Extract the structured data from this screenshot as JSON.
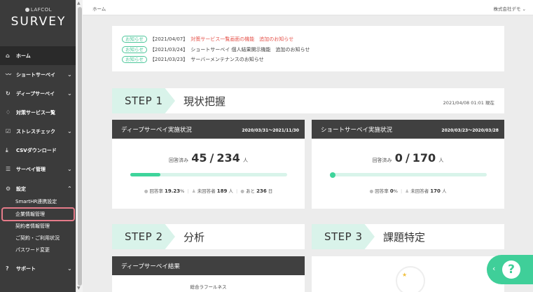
{
  "brand": {
    "sub": "LAFCOL",
    "main": "SURVEY"
  },
  "sidebar": {
    "items": [
      {
        "label": "ホーム",
        "icon": "home-icon",
        "glyph": "⌂",
        "chevron": ""
      },
      {
        "label": "ショートサーベイ",
        "icon": "chart-line-icon",
        "glyph": "〰",
        "chevron": "⌄"
      },
      {
        "label": "ディープサーベイ",
        "icon": "refresh-icon",
        "glyph": "↻",
        "chevron": "⌄"
      },
      {
        "label": "対策サービス一覧",
        "icon": "lightbulb-icon",
        "glyph": "♢",
        "chevron": ""
      },
      {
        "label": "ストレスチェック",
        "icon": "checkbox-icon",
        "glyph": "☑",
        "chevron": "⌄"
      },
      {
        "label": "CSVダウンロード",
        "icon": "download-icon",
        "glyph": "⤓",
        "chevron": ""
      },
      {
        "label": "サーベイ管理",
        "icon": "list-icon",
        "glyph": "☰",
        "chevron": "⌄"
      },
      {
        "label": "設定",
        "icon": "gear-icon",
        "glyph": "⚙",
        "chevron": "⌃"
      }
    ],
    "sub_items": [
      "SmartHR連携設定",
      "企業情報管理",
      "契約者情報管理",
      "ご契約・ご利用状況",
      "パスワード変更"
    ],
    "support": {
      "label": "サポート",
      "glyph": "?",
      "chevron": "⌄"
    }
  },
  "header": {
    "breadcrumb": "ホーム",
    "company": "株式会社デモ ⌄"
  },
  "notices": [
    {
      "tag": "お知らせ",
      "date": "【2021/04/07】",
      "title": "対策サービス一覧画面の機能　追加のお知らせ",
      "highlight": true
    },
    {
      "tag": "お知らせ",
      "date": "【2021/03/24】",
      "title": "ショートサーベイ 個人結果開示機能　追加のお知らせ",
      "highlight": false
    },
    {
      "tag": "お知らせ",
      "date": "【2021/03/23】",
      "title": "サーバーメンテナンスのお知らせ",
      "highlight": false
    }
  ],
  "step1": {
    "label": "STEP 1",
    "title": "現状把握",
    "date": "2021/04/08 01:01 現在"
  },
  "deep_panel": {
    "title": "ディープサーベイ実施状況",
    "range": "2020/03/31～2021/11/30",
    "answered_label": "回答済み",
    "answered": "45",
    "total": "234",
    "unit": "人",
    "progress": 0.1923,
    "rate_label": "回答率",
    "rate": "19.23",
    "rate_unit": "%",
    "unanswered_label": "未回答者",
    "unanswered": "189",
    "unanswered_unit": "人",
    "remain_label": "あと",
    "remain": "236",
    "remain_unit": "日"
  },
  "short_panel": {
    "title": "ショートサーベイ実施状況",
    "range": "2020/03/23～2020/03/28",
    "answered_label": "回答済み",
    "answered": "0",
    "total": "170",
    "unit": "人",
    "progress": 0,
    "rate_label": "回答率",
    "rate": "0",
    "rate_unit": "%",
    "unanswered_label": "未回答者",
    "unanswered": "170",
    "unanswered_unit": "人"
  },
  "step2": {
    "label": "STEP 2",
    "title": "分析"
  },
  "step3": {
    "label": "STEP 3",
    "title": "課題特定"
  },
  "deep_result": {
    "title": "ディープサーベイ結果",
    "sub": "総合ラフールネス"
  },
  "colors": {
    "accent": "#3fd49b",
    "sidebar": "#3b3b3b",
    "notice_red": "#e5524a"
  }
}
